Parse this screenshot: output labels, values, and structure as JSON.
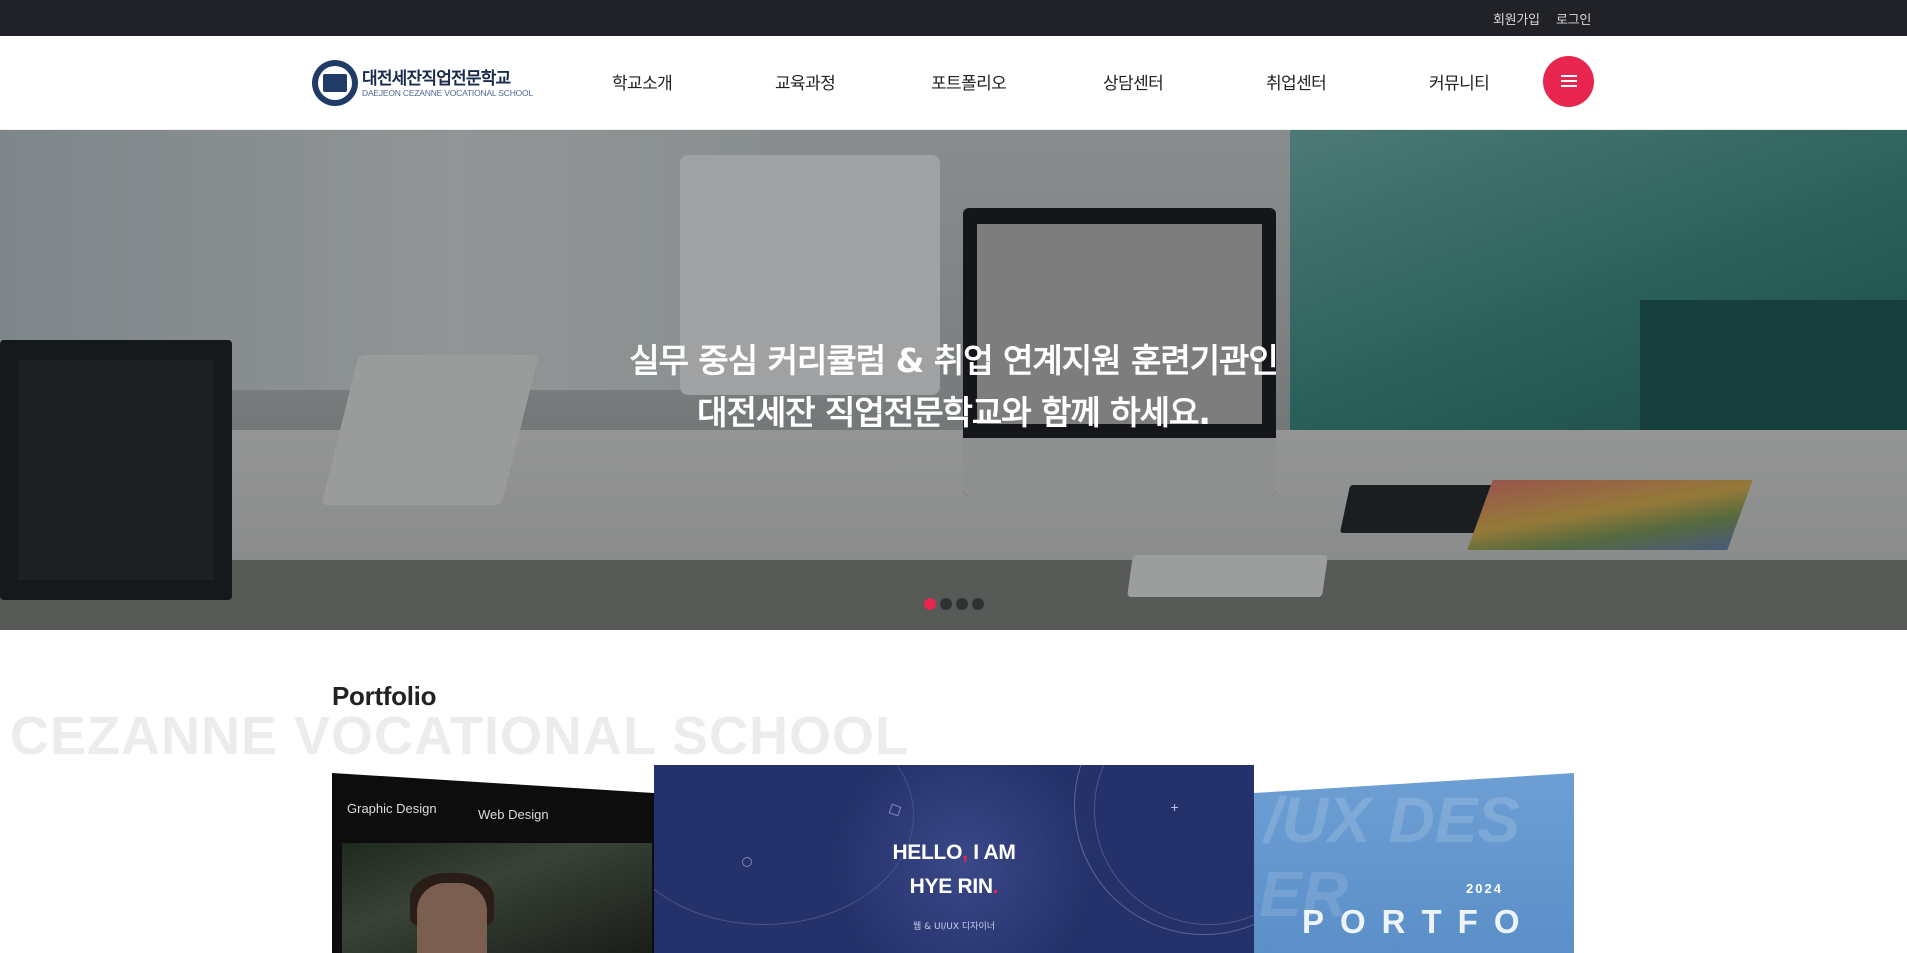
{
  "topbar": {
    "signup": "회원가입",
    "login": "로그인"
  },
  "header": {
    "logo": {
      "name_ko": "대전세잔직업전문학교",
      "name_en": "DAEJEON CEZANNE VOCATIONAL SCHOOL"
    },
    "nav": [
      {
        "label": "학교소개"
      },
      {
        "label": "교육과정"
      },
      {
        "label": "포트폴리오"
      },
      {
        "label": "상담센터"
      },
      {
        "label": "취업센터"
      },
      {
        "label": "커뮤니티"
      }
    ],
    "menu_icon": "hamburger-icon",
    "menu_color": "#e8254e"
  },
  "hero": {
    "line1": "실무 중심 커리큘럼 & 취업 연계지원 훈련기관인",
    "line2": "대전세잔 직업전문학교와 함께 하세요.",
    "slide_count": 4,
    "active_slide": 1
  },
  "portfolio": {
    "title": "Portfolio",
    "background_text": "CEZANNE VOCATIONAL SCHOOL",
    "cards": {
      "left": {
        "tab1": "Graphic Design",
        "tab2": "Web Design"
      },
      "center": {
        "hello_line1_a": "HELLO",
        "hello_line1_comma": ",",
        "hello_line1_b": " I AM",
        "hello_line2": "HYE RIN",
        "hello_line2_dot": ".",
        "subtitle": "웹 & UI/UX 디자이너"
      },
      "right": {
        "ghost_text1": "/UX DES",
        "ghost_text2": "ER",
        "year": "2024",
        "portfolio_text": "PORTFO"
      }
    }
  },
  "colors": {
    "accent": "#e8254e",
    "topbar_bg": "#212227",
    "center_card_bg": "#25316a",
    "right_card_bg": "#5b8fc8"
  }
}
